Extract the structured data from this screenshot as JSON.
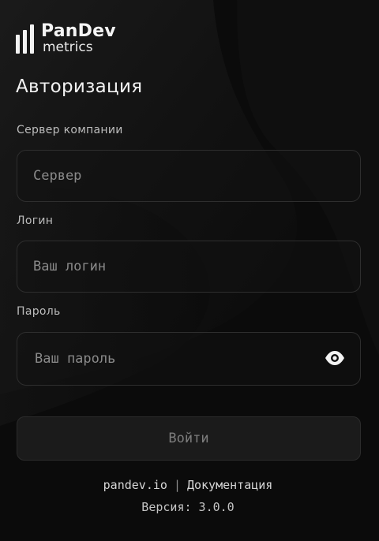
{
  "brand": {
    "name": "PanDev",
    "sub": "metrics"
  },
  "auth": {
    "title": "Авторизация",
    "server_label": "Сервер компании",
    "server_placeholder": "Сервер",
    "login_label": "Логин",
    "login_placeholder": "Ваш логин",
    "password_label": "Пароль",
    "password_placeholder": "Ваш пароль",
    "password_toggle_icon": "eye-icon",
    "submit_label": "Войти"
  },
  "footer": {
    "site_link": "pandev.io",
    "separator": "|",
    "docs_link": "Документация",
    "version": "Версия: 3.0.0"
  },
  "colors": {
    "background": "#0c0c0c",
    "field_border": "#2e2e2e",
    "button_bg": "#1b1b1b",
    "text_primary": "#f2f2f2",
    "text_muted": "#8a8a8a"
  }
}
